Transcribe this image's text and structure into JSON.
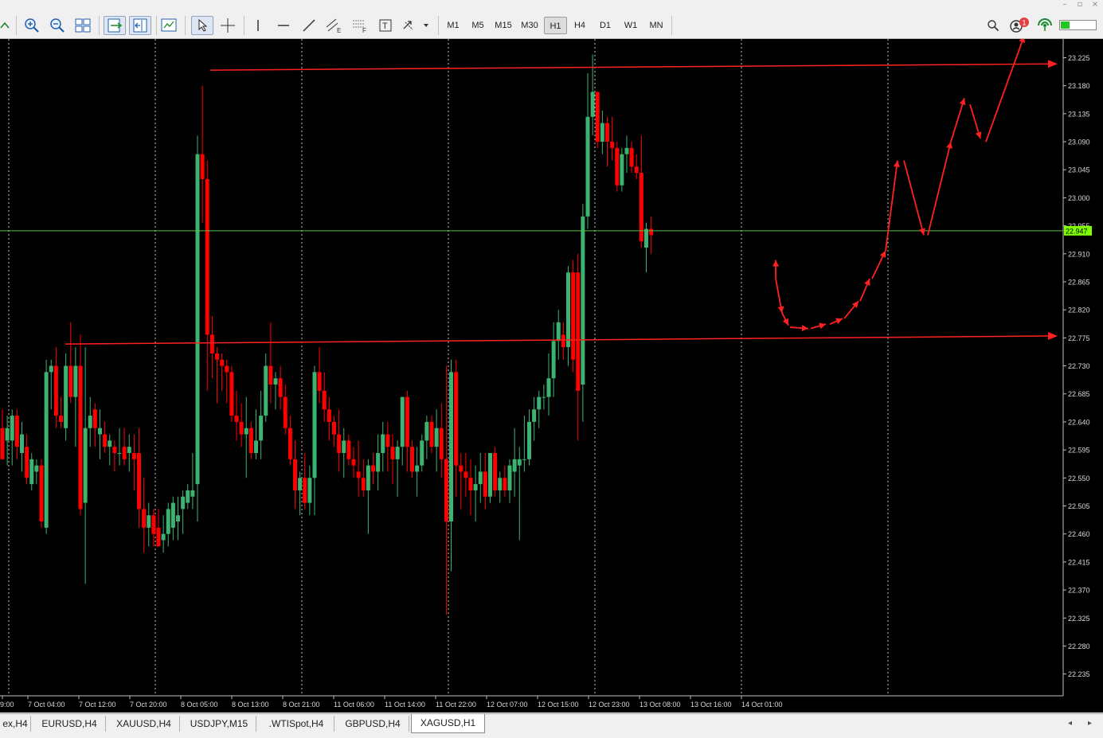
{
  "window": {
    "minimize": "–",
    "restore": "▫",
    "close": "×"
  },
  "toolbar": {
    "timeframes": [
      "M1",
      "M5",
      "M15",
      "M30",
      "H1",
      "H4",
      "D1",
      "W1",
      "MN"
    ],
    "active_timeframe": "H1",
    "notification_count": "1",
    "icons": [
      "zoom-in-icon",
      "zoom-out-icon",
      "tile-windows-icon",
      "autoscroll-icon",
      "chart-shift-icon",
      "templates-icon",
      "cursor-icon",
      "crosshair-icon",
      "vertical-line-icon",
      "horizontal-line-icon",
      "trendline-icon",
      "equidistant-channel-icon",
      "fibonacci-icon",
      "text-label-icon",
      "arrows-shapes-icon",
      "search-icon",
      "account-icon",
      "signal-icon"
    ]
  },
  "chart_data": {
    "type": "candlestick",
    "symbol": "XAGUSD",
    "timeframe": "H1",
    "ylim": [
      22.2,
      23.255
    ],
    "y_ticks": [
      "23.225",
      "23.180",
      "23.135",
      "23.090",
      "23.045",
      "23.000",
      "22.955",
      "22.910",
      "22.865",
      "22.820",
      "22.775",
      "22.730",
      "22.685",
      "22.640",
      "22.595",
      "22.550",
      "22.505",
      "22.460",
      "22.415",
      "22.370",
      "22.325",
      "22.280",
      "22.235"
    ],
    "current_price": "22.947",
    "current_price_color": "#7fff00",
    "bull_color": "#3cb371",
    "bear_color": "#ff0000",
    "background": "#000000",
    "grid": "vertical dotted",
    "x_labels": [
      "9:00",
      "7 Oct 04:00",
      "7 Oct 12:00",
      "7 Oct 20:00",
      "8 Oct 05:00",
      "8 Oct 13:00",
      "8 Oct 21:00",
      "11 Oct 06:00",
      "11 Oct 14:00",
      "11 Oct 22:00",
      "12 Oct 07:00",
      "12 Oct 15:00",
      "12 Oct 23:00",
      "13 Oct 08:00",
      "13 Oct 16:00",
      "14 Oct 01:00"
    ],
    "candles": [
      {
        "o": 22.63,
        "h": 22.66,
        "l": 22.58,
        "c": 22.58
      },
      {
        "o": 22.61,
        "h": 22.65,
        "l": 22.57,
        "c": 22.63
      },
      {
        "o": 22.61,
        "h": 22.66,
        "l": 22.57,
        "c": 22.65
      },
      {
        "o": 22.65,
        "h": 22.66,
        "l": 22.58,
        "c": 22.6
      },
      {
        "o": 22.59,
        "h": 22.64,
        "l": 22.56,
        "c": 22.62
      },
      {
        "o": 22.6,
        "h": 22.62,
        "l": 22.54,
        "c": 22.55
      },
      {
        "o": 22.54,
        "h": 22.59,
        "l": 22.53,
        "c": 22.58
      },
      {
        "o": 22.56,
        "h": 22.58,
        "l": 22.54,
        "c": 22.57
      },
      {
        "o": 22.57,
        "h": 22.58,
        "l": 22.47,
        "c": 22.48
      },
      {
        "o": 22.47,
        "h": 22.74,
        "l": 22.46,
        "c": 22.72
      },
      {
        "o": 22.72,
        "h": 22.74,
        "l": 22.66,
        "c": 22.73
      },
      {
        "o": 22.73,
        "h": 22.76,
        "l": 22.63,
        "c": 22.65
      },
      {
        "o": 22.65,
        "h": 22.68,
        "l": 22.63,
        "c": 22.64
      },
      {
        "o": 22.63,
        "h": 22.75,
        "l": 22.61,
        "c": 22.73
      },
      {
        "o": 22.73,
        "h": 22.8,
        "l": 22.67,
        "c": 22.68
      },
      {
        "o": 22.68,
        "h": 22.76,
        "l": 22.6,
        "c": 22.73
      },
      {
        "o": 22.73,
        "h": 22.78,
        "l": 22.49,
        "c": 22.5
      },
      {
        "o": 22.51,
        "h": 22.76,
        "l": 22.38,
        "c": 22.63
      },
      {
        "o": 22.63,
        "h": 22.68,
        "l": 22.6,
        "c": 22.65
      },
      {
        "o": 22.66,
        "h": 22.67,
        "l": 22.6,
        "c": 22.63
      },
      {
        "o": 22.62,
        "h": 22.66,
        "l": 22.58,
        "c": 22.63
      },
      {
        "o": 22.62,
        "h": 22.64,
        "l": 22.59,
        "c": 22.6
      },
      {
        "o": 22.6,
        "h": 22.62,
        "l": 22.57,
        "c": 22.61
      },
      {
        "o": 22.6,
        "h": 22.61,
        "l": 22.56,
        "c": 22.59
      },
      {
        "o": 22.59,
        "h": 22.63,
        "l": 22.57,
        "c": 22.59
      },
      {
        "o": 22.6,
        "h": 22.63,
        "l": 22.57,
        "c": 22.58
      },
      {
        "o": 22.59,
        "h": 22.62,
        "l": 22.56,
        "c": 22.6
      },
      {
        "o": 22.59,
        "h": 22.62,
        "l": 22.53,
        "c": 22.58
      },
      {
        "o": 22.59,
        "h": 22.63,
        "l": 22.47,
        "c": 22.5
      },
      {
        "o": 22.5,
        "h": 22.55,
        "l": 22.43,
        "c": 22.47
      },
      {
        "o": 22.47,
        "h": 22.51,
        "l": 22.44,
        "c": 22.49
      },
      {
        "o": 22.49,
        "h": 22.5,
        "l": 22.44,
        "c": 22.46
      },
      {
        "o": 22.47,
        "h": 22.5,
        "l": 22.44,
        "c": 22.44
      },
      {
        "o": 22.45,
        "h": 22.49,
        "l": 22.43,
        "c": 22.46
      },
      {
        "o": 22.46,
        "h": 22.51,
        "l": 22.44,
        "c": 22.5
      },
      {
        "o": 22.47,
        "h": 22.52,
        "l": 22.45,
        "c": 22.51
      },
      {
        "o": 22.48,
        "h": 22.52,
        "l": 22.45,
        "c": 22.49
      },
      {
        "o": 22.5,
        "h": 22.53,
        "l": 22.46,
        "c": 22.52
      },
      {
        "o": 22.51,
        "h": 22.54,
        "l": 22.5,
        "c": 22.53
      },
      {
        "o": 22.52,
        "h": 22.59,
        "l": 22.5,
        "c": 22.53
      },
      {
        "o": 22.54,
        "h": 23.1,
        "l": 22.48,
        "c": 23.07
      },
      {
        "o": 23.07,
        "h": 23.18,
        "l": 22.96,
        "c": 23.03
      },
      {
        "o": 23.03,
        "h": 23.06,
        "l": 22.69,
        "c": 22.78
      },
      {
        "o": 22.78,
        "h": 22.81,
        "l": 22.71,
        "c": 22.75
      },
      {
        "o": 22.75,
        "h": 22.76,
        "l": 22.67,
        "c": 22.74
      },
      {
        "o": 22.74,
        "h": 22.75,
        "l": 22.69,
        "c": 22.73
      },
      {
        "o": 22.73,
        "h": 22.74,
        "l": 22.67,
        "c": 22.72
      },
      {
        "o": 22.72,
        "h": 22.73,
        "l": 22.64,
        "c": 22.65
      },
      {
        "o": 22.65,
        "h": 22.69,
        "l": 22.61,
        "c": 22.64
      },
      {
        "o": 22.64,
        "h": 22.67,
        "l": 22.6,
        "c": 22.62
      },
      {
        "o": 22.62,
        "h": 22.68,
        "l": 22.55,
        "c": 22.63
      },
      {
        "o": 22.63,
        "h": 22.64,
        "l": 22.58,
        "c": 22.59
      },
      {
        "o": 22.59,
        "h": 22.66,
        "l": 22.58,
        "c": 22.61
      },
      {
        "o": 22.61,
        "h": 22.69,
        "l": 22.58,
        "c": 22.65
      },
      {
        "o": 22.65,
        "h": 22.75,
        "l": 22.64,
        "c": 22.73
      },
      {
        "o": 22.73,
        "h": 22.8,
        "l": 22.67,
        "c": 22.7
      },
      {
        "o": 22.7,
        "h": 22.72,
        "l": 22.66,
        "c": 22.71
      },
      {
        "o": 22.71,
        "h": 22.73,
        "l": 22.66,
        "c": 22.68
      },
      {
        "o": 22.68,
        "h": 22.7,
        "l": 22.62,
        "c": 22.63
      },
      {
        "o": 22.63,
        "h": 22.65,
        "l": 22.57,
        "c": 22.58
      },
      {
        "o": 22.58,
        "h": 22.61,
        "l": 22.5,
        "c": 22.53
      },
      {
        "o": 22.53,
        "h": 22.56,
        "l": 22.49,
        "c": 22.55
      },
      {
        "o": 22.55,
        "h": 22.59,
        "l": 22.5,
        "c": 22.51
      },
      {
        "o": 22.51,
        "h": 22.57,
        "l": 22.49,
        "c": 22.55
      },
      {
        "o": 22.55,
        "h": 22.73,
        "l": 22.49,
        "c": 22.72
      },
      {
        "o": 22.72,
        "h": 22.76,
        "l": 22.67,
        "c": 22.69
      },
      {
        "o": 22.69,
        "h": 22.72,
        "l": 22.64,
        "c": 22.66
      },
      {
        "o": 22.66,
        "h": 22.68,
        "l": 22.61,
        "c": 22.64
      },
      {
        "o": 22.64,
        "h": 22.65,
        "l": 22.6,
        "c": 22.62
      },
      {
        "o": 22.62,
        "h": 22.66,
        "l": 22.56,
        "c": 22.59
      },
      {
        "o": 22.59,
        "h": 22.63,
        "l": 22.55,
        "c": 22.61
      },
      {
        "o": 22.61,
        "h": 22.62,
        "l": 22.57,
        "c": 22.58
      },
      {
        "o": 22.58,
        "h": 22.6,
        "l": 22.55,
        "c": 22.57
      },
      {
        "o": 22.56,
        "h": 22.61,
        "l": 22.52,
        "c": 22.55
      },
      {
        "o": 22.55,
        "h": 22.58,
        "l": 22.52,
        "c": 22.53
      },
      {
        "o": 22.53,
        "h": 22.58,
        "l": 22.46,
        "c": 22.57
      },
      {
        "o": 22.57,
        "h": 22.59,
        "l": 22.54,
        "c": 22.56
      },
      {
        "o": 22.56,
        "h": 22.62,
        "l": 22.53,
        "c": 22.59
      },
      {
        "o": 22.59,
        "h": 22.64,
        "l": 22.56,
        "c": 22.62
      },
      {
        "o": 22.62,
        "h": 22.64,
        "l": 22.56,
        "c": 22.6
      },
      {
        "o": 22.6,
        "h": 22.62,
        "l": 22.54,
        "c": 22.58
      },
      {
        "o": 22.58,
        "h": 22.61,
        "l": 22.52,
        "c": 22.6
      },
      {
        "o": 22.6,
        "h": 22.68,
        "l": 22.57,
        "c": 22.68
      },
      {
        "o": 22.68,
        "h": 22.69,
        "l": 22.56,
        "c": 22.6
      },
      {
        "o": 22.6,
        "h": 22.61,
        "l": 22.55,
        "c": 22.56
      },
      {
        "o": 22.56,
        "h": 22.6,
        "l": 22.52,
        "c": 22.57
      },
      {
        "o": 22.57,
        "h": 22.62,
        "l": 22.56,
        "c": 22.61
      },
      {
        "o": 22.61,
        "h": 22.65,
        "l": 22.58,
        "c": 22.64
      },
      {
        "o": 22.64,
        "h": 22.65,
        "l": 22.59,
        "c": 22.6
      },
      {
        "o": 22.6,
        "h": 22.66,
        "l": 22.56,
        "c": 22.63
      },
      {
        "o": 22.63,
        "h": 22.67,
        "l": 22.55,
        "c": 22.58
      },
      {
        "o": 22.58,
        "h": 22.73,
        "l": 22.33,
        "c": 22.48
      },
      {
        "o": 22.48,
        "h": 22.74,
        "l": 22.4,
        "c": 22.72
      },
      {
        "o": 22.72,
        "h": 22.74,
        "l": 22.52,
        "c": 22.57
      },
      {
        "o": 22.57,
        "h": 22.59,
        "l": 22.5,
        "c": 22.56
      },
      {
        "o": 22.56,
        "h": 22.59,
        "l": 22.52,
        "c": 22.55
      },
      {
        "o": 22.55,
        "h": 22.58,
        "l": 22.49,
        "c": 22.53
      },
      {
        "o": 22.53,
        "h": 22.57,
        "l": 22.48,
        "c": 22.54
      },
      {
        "o": 22.54,
        "h": 22.59,
        "l": 22.51,
        "c": 22.56
      },
      {
        "o": 22.56,
        "h": 22.59,
        "l": 22.5,
        "c": 22.52
      },
      {
        "o": 22.52,
        "h": 22.59,
        "l": 22.51,
        "c": 22.59
      },
      {
        "o": 22.59,
        "h": 22.6,
        "l": 22.52,
        "c": 22.53
      },
      {
        "o": 22.53,
        "h": 22.56,
        "l": 22.51,
        "c": 22.55
      },
      {
        "o": 22.55,
        "h": 22.57,
        "l": 22.52,
        "c": 22.53
      },
      {
        "o": 22.53,
        "h": 22.58,
        "l": 22.51,
        "c": 22.57
      },
      {
        "o": 22.56,
        "h": 22.63,
        "l": 22.52,
        "c": 22.58
      },
      {
        "o": 22.57,
        "h": 22.6,
        "l": 22.45,
        "c": 22.58
      },
      {
        "o": 22.58,
        "h": 22.65,
        "l": 22.56,
        "c": 22.58
      },
      {
        "o": 22.58,
        "h": 22.66,
        "l": 22.57,
        "c": 22.64
      },
      {
        "o": 22.64,
        "h": 22.68,
        "l": 22.61,
        "c": 22.66
      },
      {
        "o": 22.66,
        "h": 22.69,
        "l": 22.63,
        "c": 22.68
      },
      {
        "o": 22.68,
        "h": 22.7,
        "l": 22.66,
        "c": 22.68
      },
      {
        "o": 22.68,
        "h": 22.75,
        "l": 22.65,
        "c": 22.71
      },
      {
        "o": 22.71,
        "h": 22.8,
        "l": 22.68,
        "c": 22.77
      },
      {
        "o": 22.77,
        "h": 22.82,
        "l": 22.74,
        "c": 22.8
      },
      {
        "o": 22.78,
        "h": 22.8,
        "l": 22.74,
        "c": 22.76
      },
      {
        "o": 22.76,
        "h": 22.89,
        "l": 22.73,
        "c": 22.88
      },
      {
        "o": 22.88,
        "h": 22.9,
        "l": 22.72,
        "c": 22.74
      },
      {
        "o": 22.88,
        "h": 22.91,
        "l": 22.61,
        "c": 22.69
      },
      {
        "o": 22.7,
        "h": 22.99,
        "l": 22.64,
        "c": 22.97
      },
      {
        "o": 22.97,
        "h": 23.2,
        "l": 22.95,
        "c": 23.13
      },
      {
        "o": 23.13,
        "h": 23.23,
        "l": 23.1,
        "c": 23.17
      },
      {
        "o": 23.17,
        "h": 23.17,
        "l": 23.08,
        "c": 23.09
      },
      {
        "o": 23.09,
        "h": 23.14,
        "l": 23.07,
        "c": 23.12
      },
      {
        "o": 23.12,
        "h": 23.13,
        "l": 23.05,
        "c": 23.09
      },
      {
        "o": 23.09,
        "h": 23.13,
        "l": 23.06,
        "c": 23.08
      },
      {
        "o": 23.08,
        "h": 23.09,
        "l": 23.01,
        "c": 23.02
      },
      {
        "o": 23.02,
        "h": 23.08,
        "l": 23.01,
        "c": 23.07
      },
      {
        "o": 23.07,
        "h": 23.1,
        "l": 23.04,
        "c": 23.08
      },
      {
        "o": 23.08,
        "h": 23.09,
        "l": 23.04,
        "c": 23.05
      },
      {
        "o": 23.05,
        "h": 23.07,
        "l": 23.03,
        "c": 23.04
      },
      {
        "o": 23.04,
        "h": 23.1,
        "l": 22.92,
        "c": 22.93
      },
      {
        "o": 22.92,
        "h": 22.96,
        "l": 22.88,
        "c": 22.95
      },
      {
        "o": 22.95,
        "h": 22.97,
        "l": 22.91,
        "c": 22.94
      }
    ],
    "resistance_line": {
      "price": 23.215,
      "color": "#ff2020"
    },
    "support_line": {
      "price": 22.778,
      "color": "#ff2020"
    },
    "forecast_path_color": "#ff2020"
  },
  "tabs": {
    "items": [
      "ex,H4",
      "EURUSD,H4",
      "XAUUSD,H4",
      "USDJPY,M15",
      ".WTISpot,H4",
      "GBPUSD,H4",
      "XAGUSD,H1"
    ],
    "active": "XAGUSD,H1",
    "scroll_left": "◂",
    "scroll_right": "▸"
  }
}
